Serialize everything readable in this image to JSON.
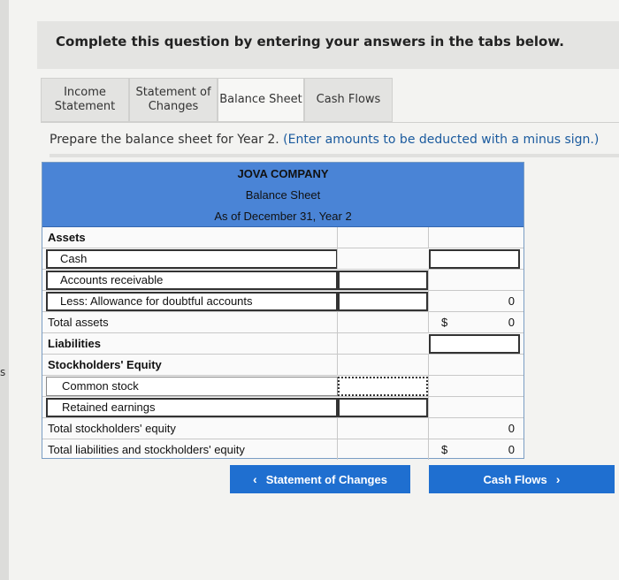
{
  "edge_letter": "s",
  "instruction": "Complete this question by entering your answers in the tabs below.",
  "tabs": [
    {
      "line1": "Income",
      "line2": "Statement"
    },
    {
      "line1": "Statement of",
      "line2": "Changes"
    },
    {
      "line1": "Balance Sheet",
      "line2": ""
    },
    {
      "line1": "Cash Flows",
      "line2": ""
    }
  ],
  "prompt": {
    "main": "Prepare the balance sheet for Year 2.",
    "hint": "(Enter amounts to be deducted with a minus sign.)"
  },
  "sheet": {
    "company": "JOVA COMPANY",
    "title": "Balance Sheet",
    "date": "As of December 31, Year 2",
    "assets_label": "Assets",
    "cash_label": "Cash",
    "ar_label": "Accounts receivable",
    "allowance_label": "Less: Allowance for doubtful accounts",
    "allowance_value": "0",
    "total_assets_label": "Total assets",
    "total_assets_currency": "$",
    "total_assets_value": "0",
    "liabilities_label": "Liabilities",
    "equity_label": "Stockholders' Equity",
    "common_stock_label": "Common stock",
    "retained_label": "Retained earnings",
    "total_equity_label": "Total stockholders' equity",
    "total_equity_value": "0",
    "total_liab_equity_label": "Total liabilities and stockholders' equity",
    "total_liab_equity_currency": "$",
    "total_liab_equity_value": "0"
  },
  "nav": {
    "prev_label": "Statement of Changes",
    "next_label": "Cash Flows",
    "prev_arrow": "‹",
    "next_arrow": "›"
  }
}
